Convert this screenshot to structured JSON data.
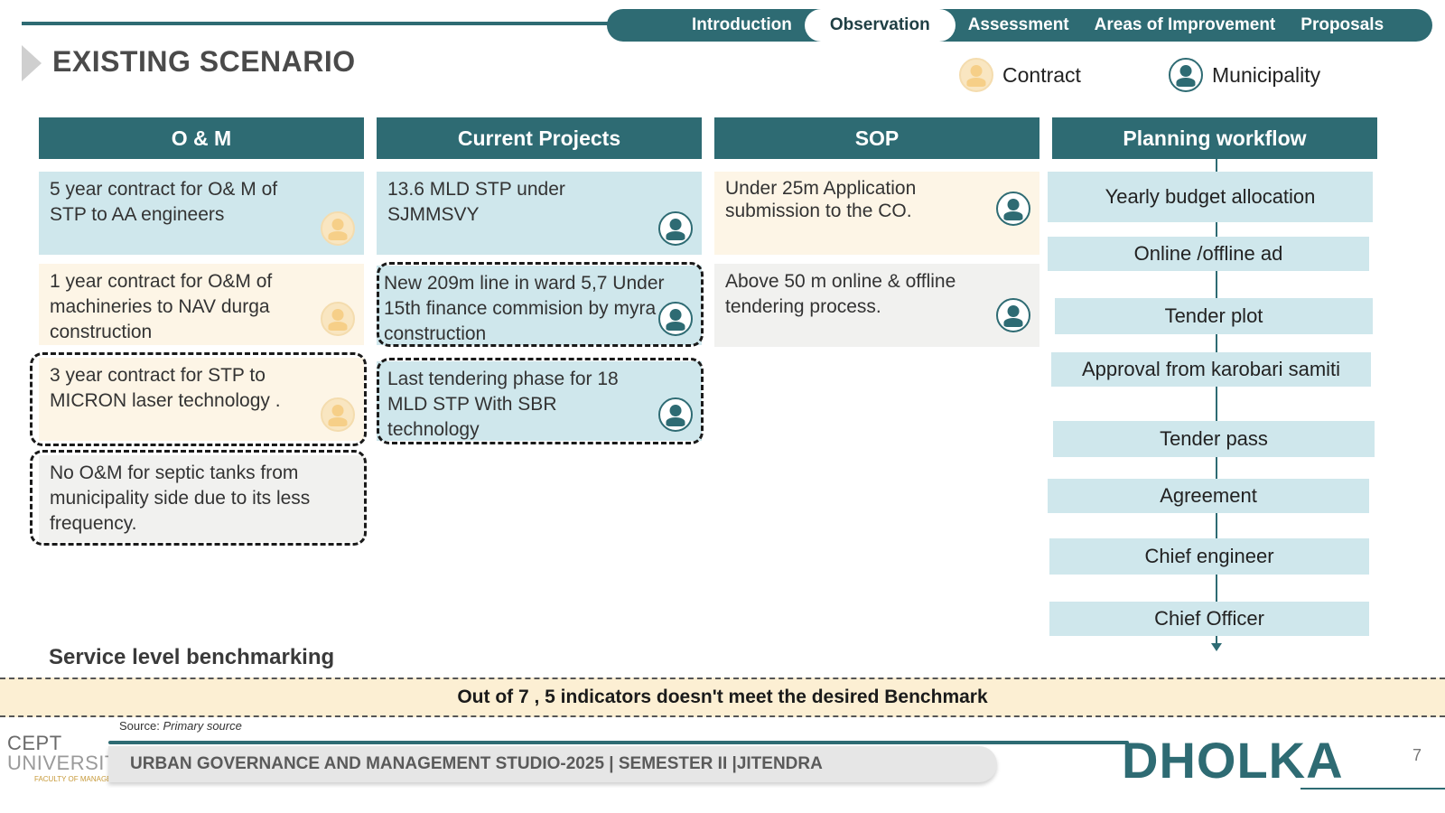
{
  "nav": {
    "tabs": [
      {
        "label": "Introduction"
      },
      {
        "label": "Observation"
      },
      {
        "label": "Assessment"
      },
      {
        "label": "Areas of Improvement"
      },
      {
        "label": "Proposals"
      }
    ],
    "active": "Observation"
  },
  "page_title": "EXISTING SCENARIO",
  "legend": {
    "contract": "Contract",
    "municipality": "Municipality"
  },
  "columns": {
    "om": {
      "header": "O & M",
      "cards": [
        {
          "text": "5 year contract for O& M of STP to  AA engineers",
          "icon": "contract"
        },
        {
          "text": "1 year contract for O&M of machineries to NAV durga construction",
          "icon": "contract"
        },
        {
          "text": "3 year contract for STP to MICRON laser technology  .",
          "icon": "contract"
        },
        {
          "text": "No O&M for septic tanks from municipality side due to its less frequency."
        }
      ]
    },
    "projects": {
      "header": "Current Projects",
      "cards": [
        {
          "text": "13.6 MLD STP under SJMMSVY",
          "icon": "municipality"
        },
        {
          "text": "New 209m line in ward 5,7 Under 15th finance commision by myra construction",
          "icon": "municipality"
        },
        {
          "text": "Last tendering phase for 18 MLD STP With SBR technology",
          "icon": "municipality"
        }
      ]
    },
    "sop": {
      "header": "SOP",
      "cards": [
        {
          "text": "Under 25m Application submission to the CO.",
          "icon": "municipality"
        },
        {
          "text": "Above 50 m online & offline tendering process.",
          "icon": "municipality"
        }
      ]
    },
    "workflow": {
      "header": "Planning workflow",
      "steps": [
        "Yearly budget allocation",
        "Online /offline ad",
        "Tender plot",
        "Approval from karobari samiti",
        "Tender pass",
        "Agreement",
        "Chief engineer",
        "Chief Officer"
      ]
    }
  },
  "service_level": {
    "label": "Service level benchmarking",
    "banner": "Out of 7 , 5 indicators doesn't meet the desired Benchmark"
  },
  "source": {
    "label": "Source:",
    "value": "Primary source"
  },
  "footer": {
    "logo_top": "CEPT",
    "logo_bottom": "UNIVERSITY",
    "logo_faculty": "FACULTY OF MANAGEMENT",
    "studio": "URBAN GOVERNANCE AND MANAGEMENT STUDIO-2025 | SEMESTER II |JITENDRA",
    "city": "DHOLKA",
    "page": "7"
  },
  "colors": {
    "primary": "#2e6b73",
    "card_blue": "#cfe7ec",
    "card_cream": "#fdf5e6",
    "card_grey": "#f1f1ef",
    "banner": "#fcefd3"
  }
}
